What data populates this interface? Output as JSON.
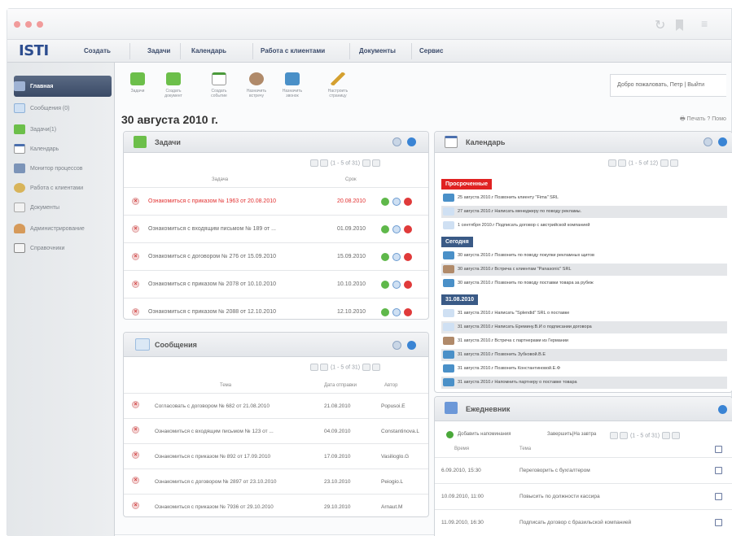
{
  "window": {
    "refresh_icon": "refresh-icon",
    "bookmark_icon": "bookmark-icon",
    "menu_icon": "hamburger-icon"
  },
  "logo": "ISTI",
  "menu": [
    "Создать",
    "Задачи",
    "Календарь",
    "Работа с клиентами",
    "Документы",
    "Сервис"
  ],
  "sidebar": {
    "items": [
      {
        "label": "Главная",
        "icon": "home-icon"
      },
      {
        "label": "Сообщения (0)",
        "icon": "mail-icon"
      },
      {
        "label": "Задачи(1)",
        "icon": "tasks-icon"
      },
      {
        "label": "Календарь",
        "icon": "calendar-icon"
      },
      {
        "label": "Монитор процессов",
        "icon": "monitor-icon"
      },
      {
        "label": "Работа с клиентами",
        "icon": "clients-icon"
      },
      {
        "label": "Документы",
        "icon": "documents-icon"
      },
      {
        "label": "Администрирование",
        "icon": "admin-icon"
      },
      {
        "label": "Справочники",
        "icon": "book-icon"
      }
    ]
  },
  "toolbar": [
    {
      "label": "Задачи"
    },
    {
      "label": "Создать документ"
    },
    {
      "label": "Создать событие"
    },
    {
      "label": "Назначить встречу"
    },
    {
      "label": "Назначить звонок"
    },
    {
      "label": "Настроить страницу"
    }
  ],
  "welcome": "Добро пожаловать, Петр | Выйти",
  "page_title": "30 августа 2010 г.",
  "print": "🖶 Печать  ? Помо",
  "tasks": {
    "title": "Задачи",
    "pager": "(1 - 5 of 31)",
    "col_task": "Задача",
    "col_due": "Срок",
    "rows": [
      {
        "text": "Ознакомиться с приказом № 1963 от 20.08.2010",
        "date": "20.08.2010",
        "overdue": true
      },
      {
        "text": "Ознакомиться с входящим письмом № 189 от ...",
        "date": "01.09.2010",
        "overdue": false
      },
      {
        "text": "Ознакомиться с договором № 276 от 15.09.2010",
        "date": "15.09.2010",
        "overdue": false
      },
      {
        "text": "Ознакомиться с приказом № 2078 от 10.10.2010",
        "date": "10.10.2010",
        "overdue": false
      },
      {
        "text": "Ознакомиться с приказом № 2088 от 12.10.2010",
        "date": "12.10.2010",
        "overdue": false
      }
    ]
  },
  "messages": {
    "title": "Сообщения",
    "pager": "(1 - 5 of 31)",
    "col_subject": "Тема",
    "col_date": "Дата отправки",
    "col_author": "Автор",
    "rows": [
      {
        "text": "Согласовать с договором № 682 от 21.08.2010",
        "date": "21.08.2010",
        "author": "Popusoi.E"
      },
      {
        "text": "Ознакомиться с входящим письмом № 123 от ...",
        "date": "04.09.2010",
        "author": "Constantinova.L"
      },
      {
        "text": "Ознакомиться с приказом № 892 от 17.09.2010",
        "date": "17.09.2010",
        "author": "Vasilioglo.G"
      },
      {
        "text": "Ознакомиться с договором № 2897 от 23.10.2010",
        "date": "23.10.2010",
        "author": "Peiogio.L"
      },
      {
        "text": "Ознакомиться с приказом № 7936 от 29.10.2010",
        "date": "29.10.2010",
        "author": "Arnaut.M"
      }
    ]
  },
  "calendar": {
    "title": "Календарь",
    "pager": "(1 - 5 of 12)",
    "sections": [
      {
        "label": "Просроченные",
        "color": "#e02222",
        "items": [
          {
            "text": "25 августа 2010.г  Позвонить клиенту \"Fima\" SRL",
            "red": true
          },
          {
            "text": "27 августа 2010.г  Написать менеджеру по поводу рекламы.",
            "red": true
          },
          {
            "text": "1 сентября 2010.г  Подписать договор с австрийской компанией",
            "red": true
          }
        ]
      },
      {
        "label": "Сегодня",
        "color": "#3a5a86",
        "items": [
          {
            "text": "30 августа 2010.г   Позвонить по поводу покупки рекламных щитов",
            "red": false
          },
          {
            "text": "30 августа 2010.г  Встреча с клиентам \"Panasonic\" SRL",
            "red": false
          },
          {
            "text": "30 августа 2010.г   Позвонить по поводу поставки товара за рубеж",
            "red": false
          }
        ]
      },
      {
        "label": "31.08.2010",
        "color": "#3a5a86",
        "items": [
          {
            "text": "31 августа 2010.г  Написать \"Splendid\" SRL о поставке",
            "red": false
          },
          {
            "text": "31 августа 2010.г  Написать Еремину.В.И о подписании договора",
            "red": false
          },
          {
            "text": "31 августа 2010.г  Встреча с партнерами из Германии",
            "red": false
          },
          {
            "text": "31 августа 2010.г  Позвонить Зубковой.В.Е",
            "red": false
          },
          {
            "text": "31 августа 2010.г  Позвонить Константиновой.Е.Ф",
            "red": false
          },
          {
            "text": "31 августа 2010.г  Напомнить партнеру о поставке товара",
            "red": false
          }
        ]
      }
    ]
  },
  "planner": {
    "title": "Ежедневник",
    "add": "Добавить напоминания",
    "finish": "Завершить|На завтра",
    "pager": "(1 - 5 of 31)",
    "col_time": "Время",
    "col_subject": "Тема",
    "rows": [
      {
        "time": "6.09.2010,  15:30",
        "text": "Переговорить с бухгалтером"
      },
      {
        "time": "10.09.2010, 11:00",
        "text": "Повысить по должности кассира"
      },
      {
        "time": "11.09.2010, 16:30",
        "text": "Подписать договор с бразильской компанией"
      }
    ]
  }
}
